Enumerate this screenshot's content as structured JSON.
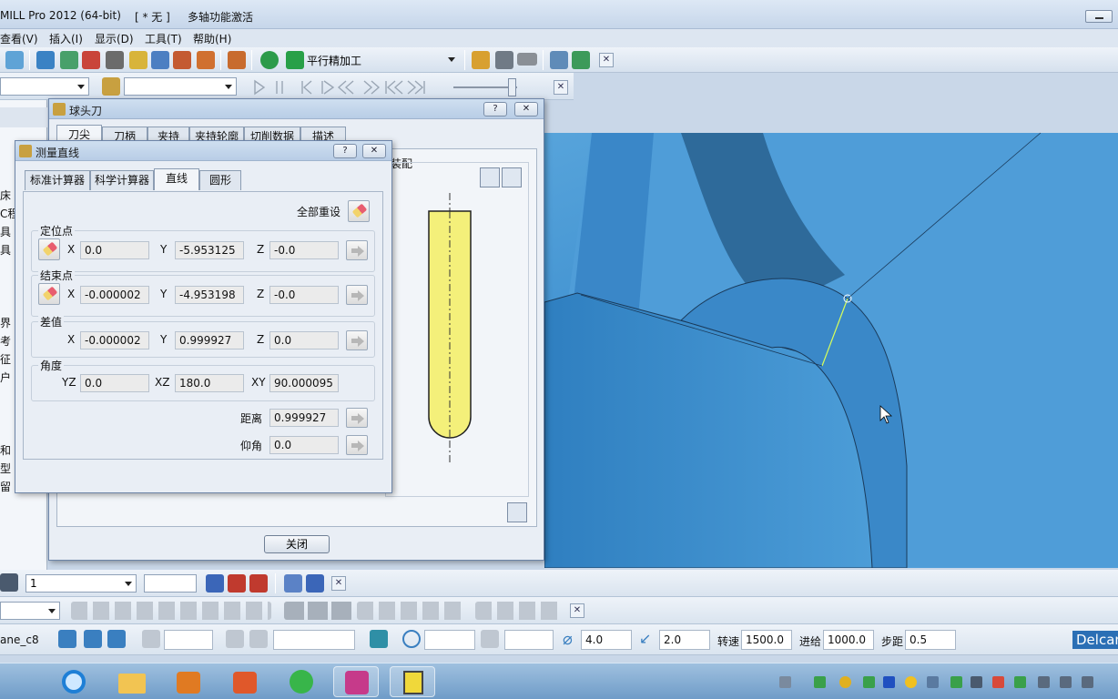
{
  "window": {
    "app_title": "MILL Pro 2012 (64-bit)",
    "project": "[ * 无 ]",
    "activation": "多轴功能激活"
  },
  "menu": [
    "查看(V)",
    "插入(I)",
    "显示(D)",
    "工具(T)",
    "帮助(H)"
  ],
  "toolbar": {
    "strategy": "平行精加工",
    "combo2": "",
    "combo3": ""
  },
  "left_panel": {
    "fragments": [
      "床",
      "C程",
      "具",
      "具",
      "界",
      "考",
      "征",
      "户",
      "和",
      "型",
      "留"
    ]
  },
  "tool_dialog": {
    "title": "球头刀",
    "tabs": [
      "刀尖",
      "刀柄",
      "夹持",
      "夹持轮廓",
      "切削数据",
      "描述"
    ],
    "assembly_label": "装配",
    "close_label": "关闭",
    "help": "?",
    "close_x": "✕"
  },
  "measure_dialog": {
    "title": "测量直线",
    "help": "?",
    "close_x": "✕",
    "tabs": [
      "标准计算器",
      "科学计算器",
      "直线",
      "圆形"
    ],
    "active_tab": "直线",
    "reset_all": "全部重设",
    "start": {
      "label": "定位点",
      "x": "0.0",
      "y": "-5.953125",
      "z": "-0.0"
    },
    "end": {
      "label": "结束点",
      "x": "-0.000002",
      "y": "-4.953198",
      "z": "-0.0"
    },
    "delta": {
      "label": "差值",
      "x": "-0.000002",
      "y": "0.999927",
      "z": "0.0"
    },
    "angle": {
      "label": "角度",
      "yz": "0.0",
      "xz": "180.0",
      "xy": "90.000095"
    },
    "axis": {
      "x": "X",
      "y": "Y",
      "z": "Z",
      "yz": "YZ",
      "xz": "XZ",
      "xy": "XY"
    },
    "distance": {
      "label": "距离",
      "value": "0.999927"
    },
    "elevation": {
      "label": "仰角",
      "value": "0.0"
    }
  },
  "bottom_toolbar": {
    "layer_combo": "1"
  },
  "status": {
    "workplane": "ane_c8",
    "tool_diameter": "4.0",
    "tool_tip": "2.0",
    "speed_label": "转速",
    "speed": "1500.0",
    "feed_label": "进给",
    "feed": "1000.0",
    "step_label": "步距",
    "step": "0.5",
    "brand": "Delcam"
  },
  "colors": {
    "viewport": "#3d8fcf",
    "tool_body": "#f4f07a",
    "title_bar": "#c6d6ea",
    "dialog_bg": "#e9eef5"
  }
}
